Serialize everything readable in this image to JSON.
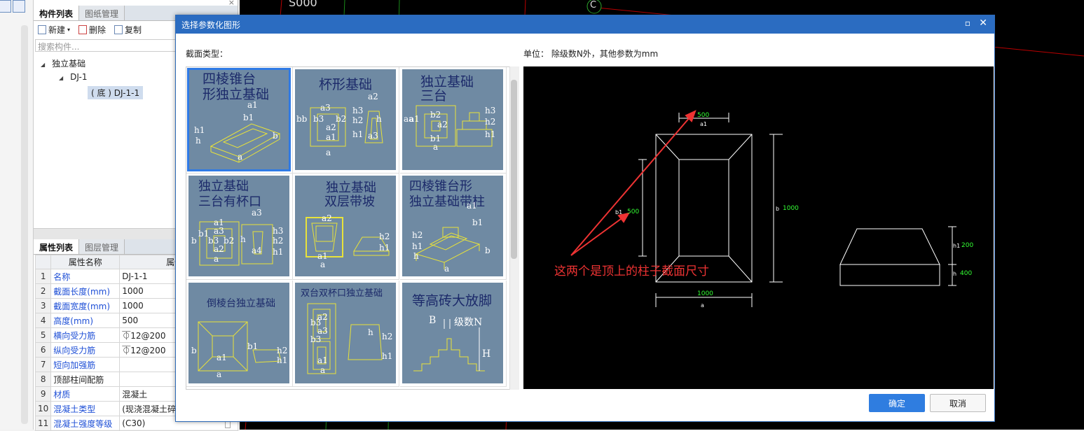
{
  "cad": {
    "label_s": "S000",
    "axis_c": "C"
  },
  "left_tabs": [
    "构件列表",
    "图纸管理"
  ],
  "toolbar": {
    "new": "新建",
    "delete": "删除",
    "copy": "复制"
  },
  "search_placeholder": "搜索构件...",
  "tree": {
    "root": "独立基础",
    "child": "DJ-1",
    "leaf": "( 底 ) DJ-1-1"
  },
  "prop_tabs": [
    "属性列表",
    "图层管理"
  ],
  "props_header": {
    "name": "属性名称",
    "value": "属性值"
  },
  "props": [
    {
      "n": "1",
      "name": "名称",
      "value": "DJ-1-1"
    },
    {
      "n": "2",
      "name": "截面长度(mm)",
      "value": "1000"
    },
    {
      "n": "3",
      "name": "截面宽度(mm)",
      "value": "1000"
    },
    {
      "n": "4",
      "name": "高度(mm)",
      "value": "500"
    },
    {
      "n": "5",
      "name": "横向受力筋",
      "value": "⏁12@200"
    },
    {
      "n": "6",
      "name": "纵向受力筋",
      "value": "⏁12@200"
    },
    {
      "n": "7",
      "name": "短向加强筋",
      "value": ""
    },
    {
      "n": "8",
      "name": "顶部柱间配筋",
      "value": ""
    },
    {
      "n": "9",
      "name": "材质",
      "value": "混凝土"
    },
    {
      "n": "10",
      "name": "混凝土类型",
      "value": "(现浇混凝土碎"
    },
    {
      "n": "11",
      "name": "混凝土强度等级",
      "value": "(C30)"
    }
  ],
  "dialog": {
    "title": "选择参数化图形",
    "section_label": "截面类型：",
    "unit_label": "单位：  除级数N外，其他参数为mm",
    "ok": "确定",
    "cancel": "取消"
  },
  "shapes": [
    {
      "l1": "四棱锥台",
      "l2": "形独立基础"
    },
    {
      "l1": "杯形基础",
      "l2": ""
    },
    {
      "l1": "独立基础",
      "l2": "三台"
    },
    {
      "l1": "独立基础",
      "l2": "三台有杯口"
    },
    {
      "l1": "独立基础",
      "l2": "双层带坡"
    },
    {
      "l1": "四棱锥台形",
      "l2": "独立基础带柱"
    },
    {
      "l1": "倒棱台独立基础",
      "l2": ""
    },
    {
      "l1": "双台双杯口独立基础",
      "l2": ""
    },
    {
      "l1": "等高砖大放脚",
      "l2": ""
    }
  ],
  "thumb_marks": {
    "a": "a",
    "b": "b",
    "a1": "a1",
    "b1": "b1",
    "h": "h",
    "h1": "h1",
    "a2": "a2",
    "b2": "b2",
    "a3": "a3",
    "b3": "b3",
    "h2": "h2",
    "h3": "h3",
    "a4": "a4",
    "bb": "bb",
    "aa": "aa",
    "big_b": "B",
    "big_h": "H",
    "jishu": "级数N"
  },
  "preview": {
    "top_dim": "500",
    "top_lbl": "a1",
    "left_lbl": "b1",
    "left_dim": "500",
    "right_lbl": "b",
    "right_dim": "1000",
    "bottom_dim": "1000",
    "bottom_lbl": "a",
    "h1_lbl": "h1",
    "h1_dim": "200",
    "h_lbl": "h",
    "h_dim": "400",
    "annotation": "这两个是顶上的柱子截面尺寸"
  }
}
